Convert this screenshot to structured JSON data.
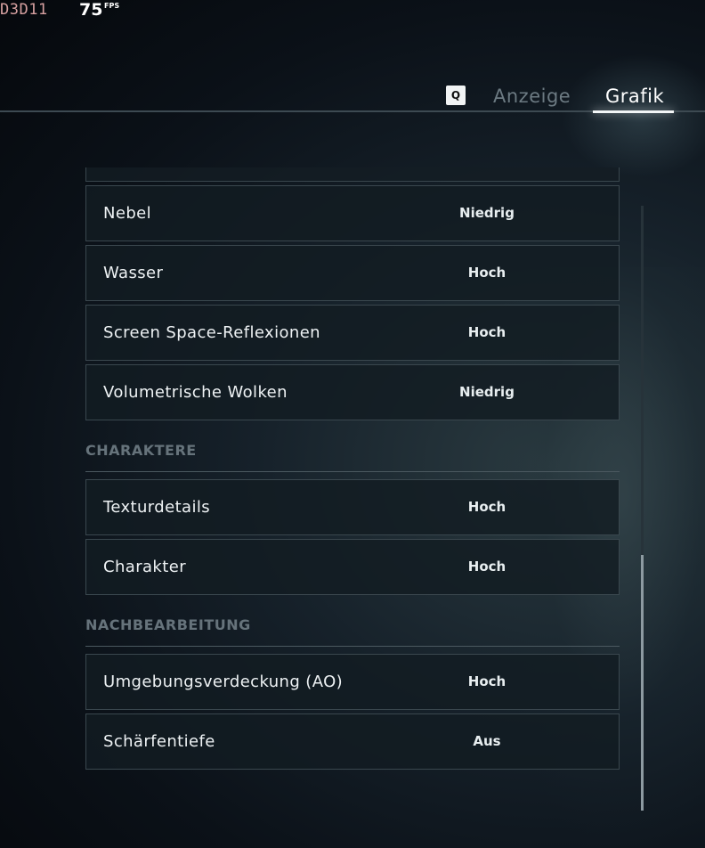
{
  "hud": {
    "api": "D3D11",
    "fps_value": "75",
    "fps_unit": "FPS"
  },
  "tabs": {
    "key_hint": "Q",
    "items": [
      {
        "label": "Anzeige",
        "active": false
      },
      {
        "label": "Grafik",
        "active": true
      }
    ]
  },
  "settings": {
    "rows_top": [
      {
        "label": "Nebel",
        "value": "Niedrig"
      },
      {
        "label": "Wasser",
        "value": "Hoch"
      },
      {
        "label": "Screen Space-Reflexionen",
        "value": "Hoch"
      },
      {
        "label": "Volumetrische Wolken",
        "value": "Niedrig"
      }
    ],
    "section_characters": {
      "title": "CHARAKTERE",
      "rows": [
        {
          "label": "Texturdetails",
          "value": "Hoch"
        },
        {
          "label": "Charakter",
          "value": "Hoch"
        }
      ]
    },
    "section_post": {
      "title": "NACHBEARBEITUNG",
      "rows": [
        {
          "label": "Umgebungsverdeckung (AO)",
          "value": "Hoch"
        },
        {
          "label": "Schärfentiefe",
          "value": "Aus"
        }
      ]
    }
  },
  "colors": {
    "accent": "#f3f6f7",
    "background": "#0b1118",
    "inactive_tab": "#6c7a82",
    "section_title": "#66737b",
    "fps_api": "#d7a1a1"
  }
}
